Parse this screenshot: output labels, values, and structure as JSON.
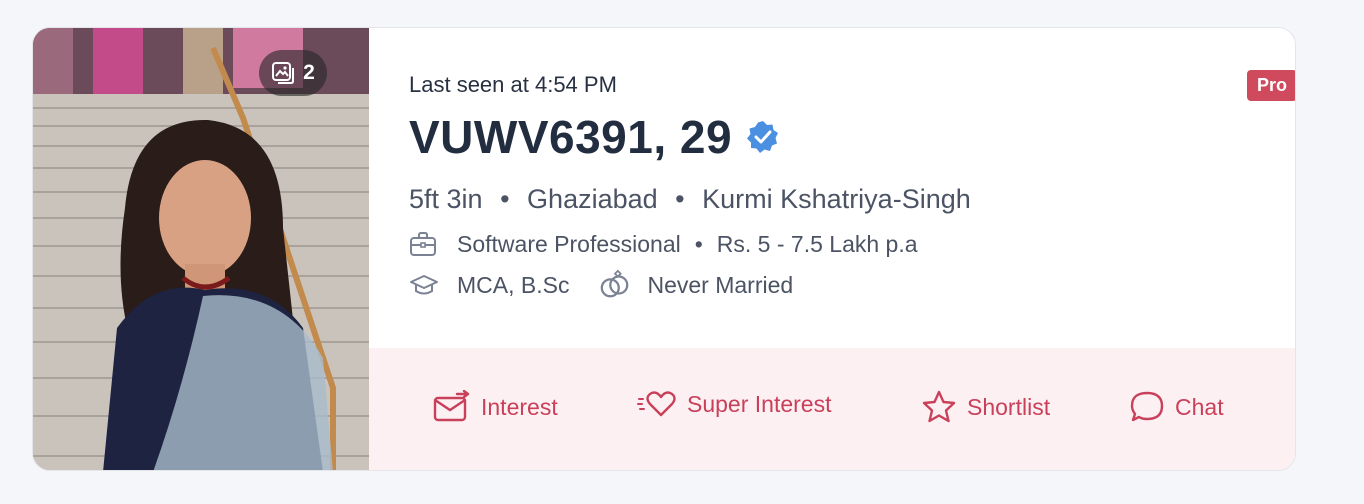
{
  "profile": {
    "photo_count": "2",
    "last_seen": "Last seen at 4:54 PM",
    "badge": "Pro",
    "name_age": "VUWV6391, 29",
    "height": "5ft 3in",
    "city": "Ghaziabad",
    "community": "Kurmi Kshatriya-Singh",
    "profession": "Software Professional",
    "income": "Rs. 5 - 7.5 Lakh p.a",
    "education": "MCA, B.Sc",
    "marital_status": "Never Married",
    "separator": "•"
  },
  "actions": {
    "interest": "Interest",
    "super_interest": "Super Interest",
    "shortlist": "Shortlist",
    "chat": "Chat"
  },
  "colors": {
    "accent": "#c9405a",
    "badge": "#cf4a5d",
    "verified": "#4a8fe0",
    "action_bg": "#fdf0f2"
  },
  "icons": {
    "photos": "photos-icon",
    "verified": "verified-badge-icon",
    "briefcase": "briefcase-icon",
    "graduation": "graduation-cap-icon",
    "rings": "rings-icon",
    "interest": "mail-arrow-icon",
    "super_interest": "heart-icon",
    "shortlist": "star-icon",
    "chat": "chat-bubble-icon"
  }
}
